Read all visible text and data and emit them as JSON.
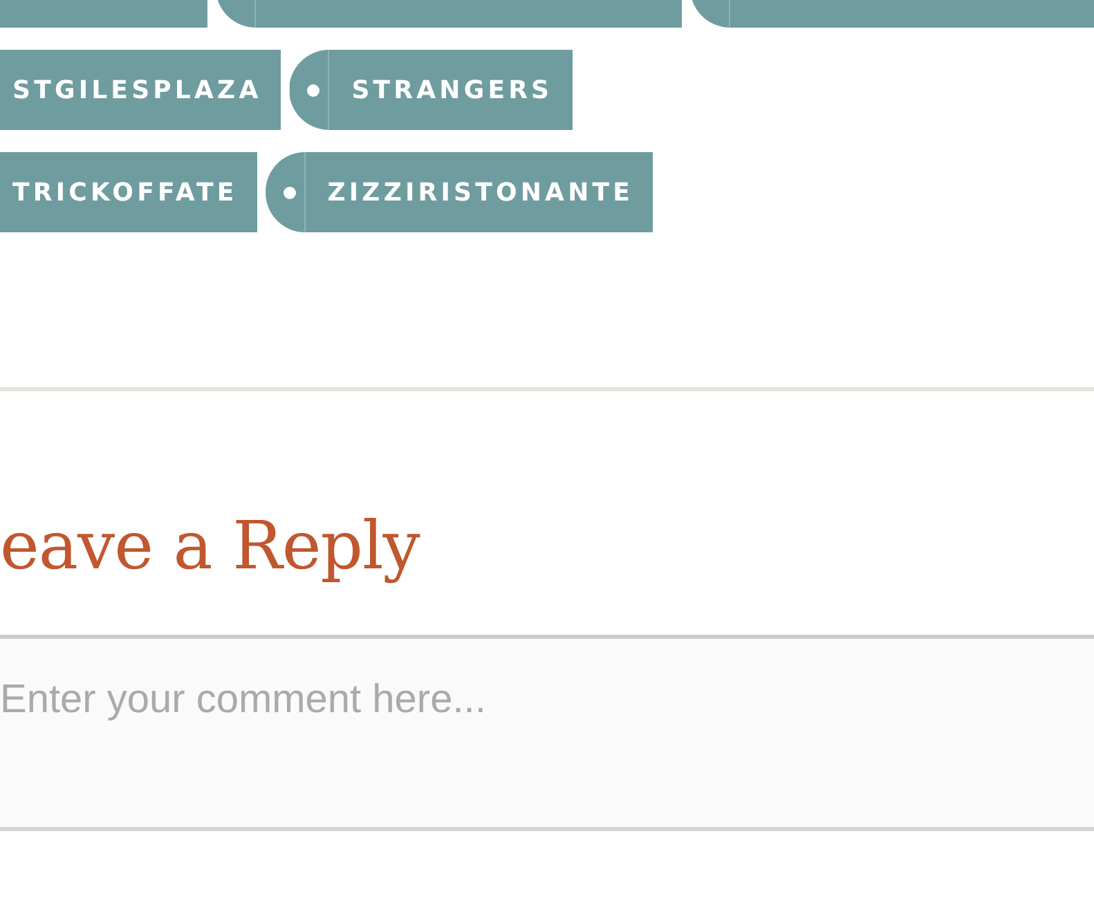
{
  "tag_rows": [
    [
      {
        "kind": "cut"
      },
      {
        "kind": "cut"
      },
      {
        "kind": "cut"
      }
    ],
    [
      {
        "kind": "tag",
        "label": "STGILESPLAZA"
      },
      {
        "kind": "tag",
        "label": "STRANGERS"
      }
    ],
    [
      {
        "kind": "tag",
        "label": "TRICKOFFATE"
      },
      {
        "kind": "tag",
        "label": "ZIZZIRISTONANTE"
      }
    ]
  ],
  "reply": {
    "title": "eave a Reply",
    "comment": {
      "placeholder": "Enter your comment here..."
    }
  }
}
